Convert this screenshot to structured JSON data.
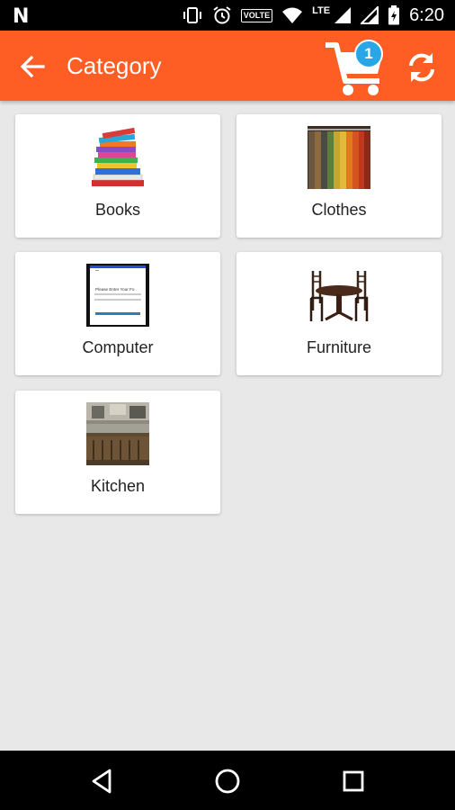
{
  "status_bar": {
    "left_icon": "N",
    "volte": "VOLTE",
    "lte": "LTE",
    "time": "6:20"
  },
  "app_bar": {
    "title": "Category",
    "cart_count": "1",
    "back_icon": "arrow-left-icon",
    "cart_icon": "cart-icon",
    "refresh_icon": "refresh-icon",
    "color": "#fe5d24"
  },
  "categories": [
    {
      "label": "Books"
    },
    {
      "label": "Clothes"
    },
    {
      "label": "Computer"
    },
    {
      "label": "Furniture"
    },
    {
      "label": "Kitchen"
    }
  ],
  "computer_thumb_text": "Please Enter Your Fo",
  "nav_bar": {
    "back_icon": "triangle-back-icon",
    "home_icon": "circle-home-icon",
    "recents_icon": "square-recents-icon"
  }
}
